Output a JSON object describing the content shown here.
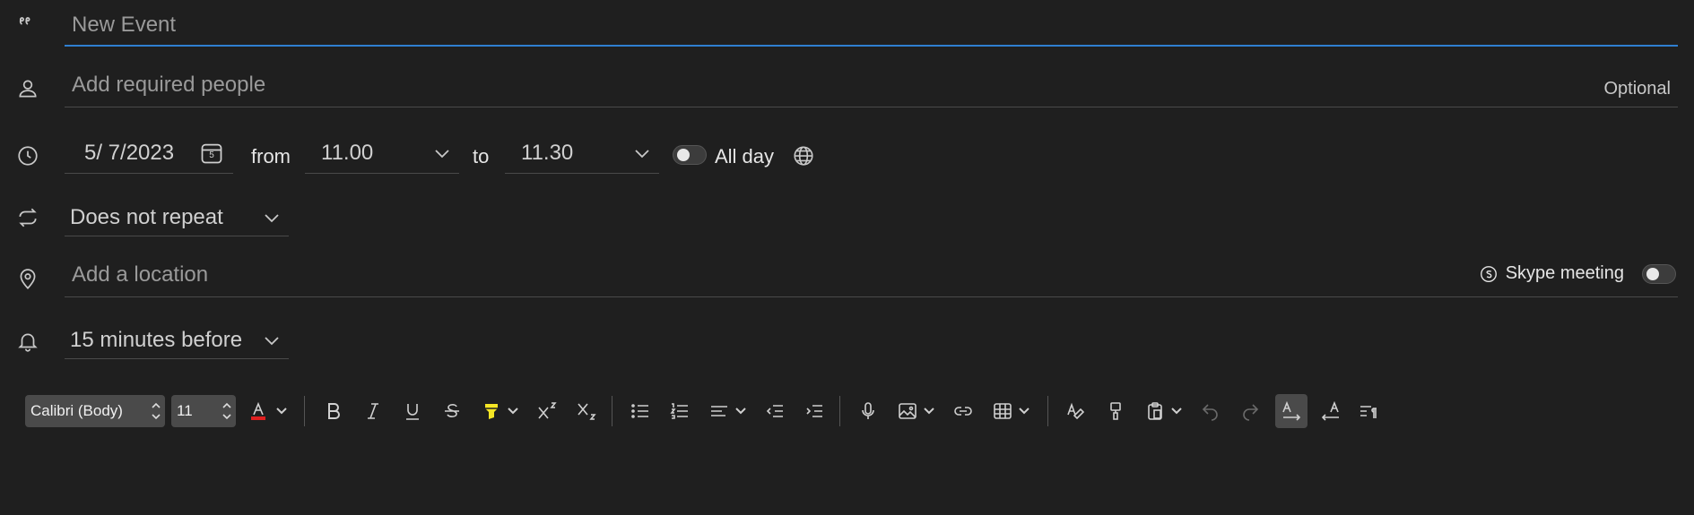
{
  "title_field": {
    "placeholder": "New Event"
  },
  "people_field": {
    "placeholder": "Add required people",
    "optional_label": "Optional"
  },
  "datetime": {
    "date": "5/  7/2023",
    "calendar_day": "5",
    "from_label": "from",
    "start_time": "11.00",
    "to_label": "to",
    "end_time": "11.30",
    "all_day_label": "All day"
  },
  "repeat": {
    "value": "Does not repeat"
  },
  "location": {
    "placeholder": "Add a location",
    "skype_label": "Skype meeting"
  },
  "reminder": {
    "value": "15 minutes before"
  },
  "toolbar": {
    "font_name": "Calibri (Body)",
    "font_size": "11",
    "font_color": "#e02020",
    "highlight_color": "#f5e625",
    "icons": [
      "font-color-icon",
      "bold-icon",
      "italic-icon",
      "underline-icon",
      "strikethrough-icon",
      "highlight-icon",
      "superscript-icon",
      "subscript-icon",
      "bullets-icon",
      "numbering-icon",
      "align-icon",
      "decrease-indent-icon",
      "increase-indent-icon",
      "dictate-icon",
      "image-icon",
      "link-icon",
      "table-icon",
      "clear-formatting-icon",
      "format-painter-icon",
      "paste-icon",
      "undo-icon",
      "redo-icon",
      "ltr-icon",
      "rtl-icon",
      "paragraph-marks-icon"
    ]
  },
  "colors": {
    "background": "#1f1f1f",
    "accent": "#2f7fd0",
    "divider": "#4a4a4a"
  }
}
